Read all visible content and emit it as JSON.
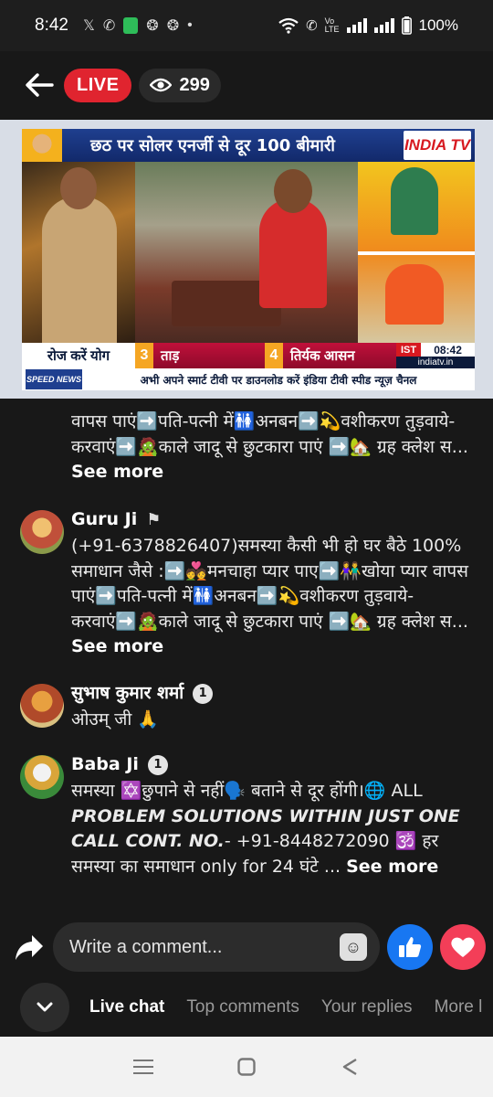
{
  "status_bar": {
    "time": "8:42",
    "left_icons": [
      "x-icon",
      "whatsapp-icon",
      "app-icon",
      "app-icon",
      "app-icon",
      "dot-icon"
    ],
    "battery": "100%"
  },
  "header": {
    "live_label": "LIVE",
    "viewer_count": "299"
  },
  "video": {
    "headline": "छठ पर सोलर एनर्जी से दूर 100 बीमारी",
    "channel_logo": "INDIA TV",
    "lower_third": {
      "segment": "रोज करें योग",
      "pose1_num": "3",
      "pose1_name": "ताड़",
      "pose2_num": "4",
      "pose2_name": "तिर्यक आसन",
      "ist": "IST",
      "clock": "08:42",
      "site": "indiatv.in"
    },
    "ticker_logo": "SPEED NEWS",
    "ticker_text": "अभी अपने स्मार्ट टीवी पर डाउनलोड करें इंडिया टीवी स्पीड न्यूज़ चैनल"
  },
  "comments": [
    {
      "name": "",
      "text": "वापस पाएं➡️पति-पत्नी में🚻अनबन➡️💫वशीकरण तुड़वाये-करवाएं➡️🧟काले जादू से छुटकारा पाएं ➡️🏡 ग्रह क्लेश स...",
      "see_more": "See more"
    },
    {
      "name": "Guru Ji",
      "text": "(+91-6378826407)समस्या कैसी भी हो घर बैठे 100% समाधान जैसे :➡️💑मनचाहा प्यार पाए➡️👫खोया प्यार वापस पाएं➡️पति-पत्नी में🚻अनबन➡️💫वशीकरण तुड़वाये-करवाएं➡️🧟काले जादू से छुटकारा पाएं ➡️🏡 ग्रह क्लेश स...",
      "see_more": "See more"
    },
    {
      "name": "सुभाष कुमार शर्मा",
      "badge": "1",
      "text": "ओउम् जी 🙏"
    },
    {
      "name": "Baba Ji",
      "badge": "1",
      "text_a": "समस्या ✡️छुपाने से नहीं🗣️ बताने से दूर होंगी।🌐 ALL",
      "text_b": "PROBLEM SOLUTIONS WITHIN JUST ONE CALL CONT. NO.",
      "text_c": "- +91-8448272090 🕉️ हर समस्या का समाधान only for 24  घंटे ...",
      "see_more": "See more"
    }
  ],
  "composer": {
    "placeholder": "Write a comment..."
  },
  "tabs": [
    "Live chat",
    "Top comments",
    "Your replies",
    "More l"
  ],
  "colors": {
    "live_red": "#e0242f",
    "like_blue": "#1877f2",
    "love_red": "#f33e58",
    "background": "#181818"
  }
}
